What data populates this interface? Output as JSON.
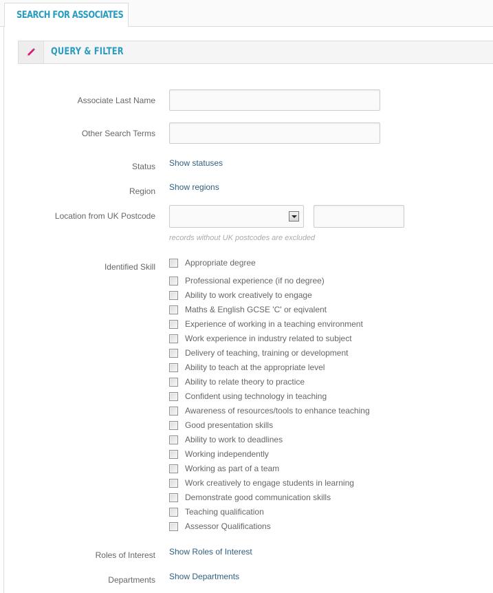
{
  "tab": {
    "label": "Search for Associates"
  },
  "panel": {
    "title": "Query & Filter",
    "icon": "pencil-icon",
    "accent": "#e0177a"
  },
  "colors": {
    "heading": "#2a9cc0",
    "link": "#2f5f7f",
    "label": "#666666"
  },
  "fields": {
    "last_name": {
      "label": "Associate Last Name",
      "value": "",
      "placeholder": ""
    },
    "other_terms": {
      "label": "Other Search Terms",
      "value": "",
      "placeholder": ""
    },
    "status": {
      "label": "Status",
      "link": "Show statuses"
    },
    "region": {
      "label": "Region",
      "link": "Show regions"
    },
    "location": {
      "label": "Location from UK Postcode",
      "select_value": "",
      "postcode_value": "",
      "hint": "records without UK postcodes are excluded"
    },
    "skills": {
      "label": "Identified Skill",
      "items": [
        {
          "label": "Appropriate degree",
          "checked": false
        },
        {
          "label": "Professional experience (if no degree)",
          "checked": false
        },
        {
          "label": "Ability to work creatively to engage",
          "checked": false
        },
        {
          "label": "Maths & English GCSE 'C' or eqivalent",
          "checked": false
        },
        {
          "label": "Experience of working in a teaching environment",
          "checked": false
        },
        {
          "label": "Work experience in industry related to subject",
          "checked": false
        },
        {
          "label": "Delivery of teaching, training or development",
          "checked": false
        },
        {
          "label": "Ability to teach at the appropriate level",
          "checked": false
        },
        {
          "label": "Ability to relate theory to practice",
          "checked": false
        },
        {
          "label": "Confident using technology in teaching",
          "checked": false
        },
        {
          "label": "Awareness of resources/tools to enhance teaching",
          "checked": false
        },
        {
          "label": "Good presentation skills",
          "checked": false
        },
        {
          "label": "Ability to work to deadlines",
          "checked": false
        },
        {
          "label": "Working independently",
          "checked": false
        },
        {
          "label": "Working as part of a team",
          "checked": false
        },
        {
          "label": "Work creatively to engage students in learning",
          "checked": false
        },
        {
          "label": "Demonstrate good communication skills",
          "checked": false
        },
        {
          "label": "Teaching qualification",
          "checked": false
        },
        {
          "label": "Assessor Qualifications",
          "checked": false
        }
      ]
    },
    "roles": {
      "label": "Roles of Interest",
      "link": "Show Roles of Interest"
    },
    "departments": {
      "label": "Departments",
      "link": "Show Departments"
    }
  }
}
